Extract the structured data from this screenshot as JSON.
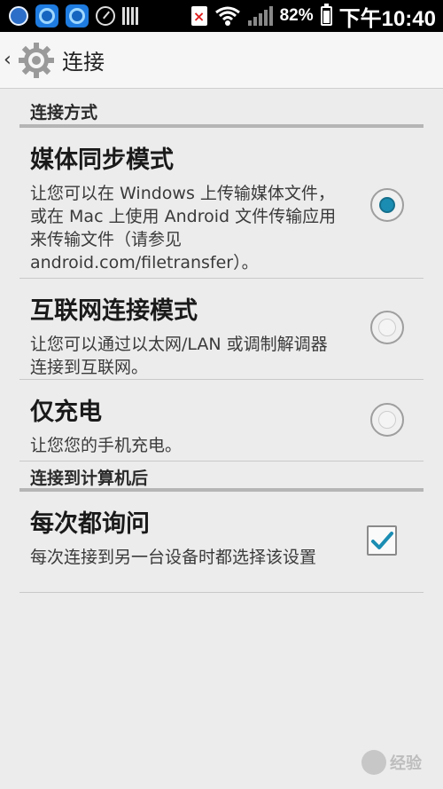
{
  "status_bar": {
    "battery": "82%",
    "time": "下午10:40",
    "alert_mark": "×"
  },
  "header": {
    "back_glyph": "‹",
    "title": "连接"
  },
  "sections": [
    {
      "title": "连接方式"
    },
    {
      "title": "连接到计算机后"
    }
  ],
  "options": [
    {
      "title": "媒体同步模式",
      "desc": "让您可以在 Windows 上传输媒体文件，或在 Mac 上使用 Android 文件传输应用来传输文件（请参见 android.com/filetransfer）。",
      "selected": true
    },
    {
      "title": "互联网连接模式",
      "desc": "让您可以通过以太网/LAN 或调制解调器连接到互联网。",
      "selected": false
    },
    {
      "title": "仅充电",
      "desc": "让您您的手机充电。",
      "selected": false
    }
  ],
  "ask_option": {
    "title": "每次都询问",
    "desc": "每次连接到另一台设备时都选择该设置",
    "checked": true
  },
  "colors": {
    "accent": "#1b8db3",
    "background": "#ececec",
    "divider": "#b5b5b5"
  },
  "watermark": {
    "text": "经验"
  }
}
